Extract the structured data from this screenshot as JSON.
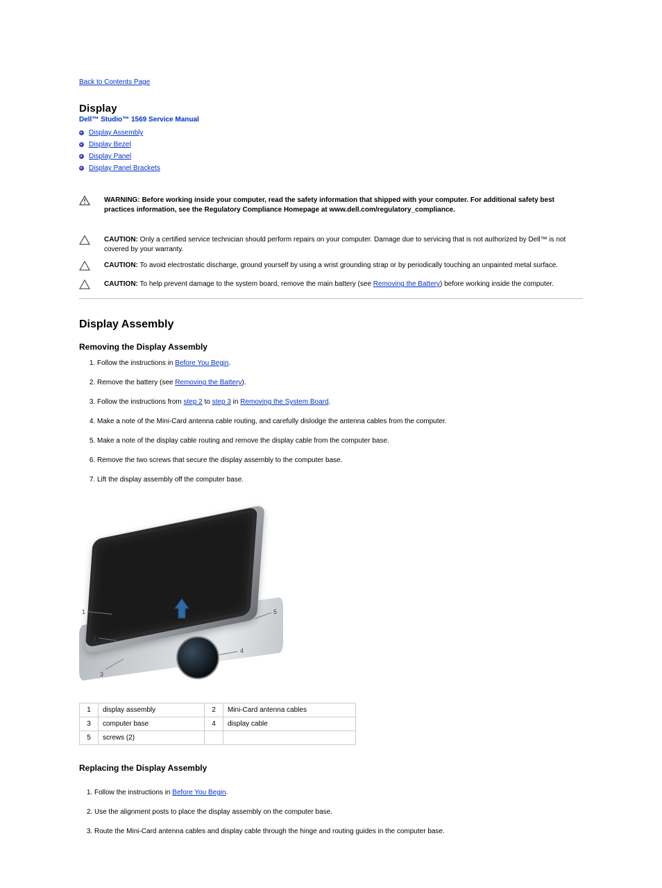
{
  "back_link": "Back to Contents Page",
  "page_title": "Display",
  "subtitle": "Dell™ Studio™ 1569 Service Manual",
  "nav": [
    "Display Assembly",
    "Display Bezel",
    "Display Panel",
    "Display Panel Brackets"
  ],
  "warning": {
    "label": "WARNING:",
    "body": "Before working inside your computer, read the safety information that shipped with your computer. For additional safety best practices information, see the Regulatory Compliance Homepage at www.dell.com/regulatory_compliance."
  },
  "cautions": [
    {
      "label": "CAUTION:",
      "body": "Only a certified service technician should perform repairs on your computer. Damage due to servicing that is not authorized by Dell™ is not covered by your warranty."
    },
    {
      "label": "CAUTION:",
      "body": "To avoid electrostatic discharge, ground yourself by using a wrist grounding strap or by periodically touching an unpainted metal surface."
    },
    {
      "label": "CAUTION:",
      "body_before_link": "To help prevent damage to the system board, remove the main battery (see ",
      "link_text": "Removing the Battery",
      "body_after_link": ") before working inside the computer."
    }
  ],
  "sect1_title": "Display Assembly",
  "sect2a_title": "Removing the Display Assembly",
  "steps_a": [
    {
      "text_before": "Follow the instructions in ",
      "link": "Before You Begin",
      "text_after": "."
    },
    {
      "text_before": "Remove the battery (see ",
      "link": "Removing the Battery",
      "text_after": ")."
    },
    {
      "text_before": "Follow the instructions from ",
      "link1": "step 2",
      "mid": " to ",
      "link2": "step 3",
      "post": " in ",
      "link3": "Removing the System Board",
      "text_after": "."
    },
    {
      "text_plain": "Make a note of the Mini-Card antenna cable routing, and carefully dislodge the antenna cables from the computer."
    },
    {
      "text_plain": "Make a note of the display cable routing and remove the display cable from the computer base."
    },
    {
      "text_plain": "Remove the two screws that secure the display assembly to the computer base."
    },
    {
      "text_plain": "Lift the display assembly off the computer base."
    }
  ],
  "table": [
    [
      {
        "n": "1",
        "t": "display assembly"
      },
      {
        "n": "2",
        "t": "Mini-Card antenna cables"
      }
    ],
    [
      {
        "n": "3",
        "t": "computer base"
      },
      {
        "n": "4",
        "t": "display cable"
      }
    ],
    [
      {
        "n": "5",
        "t": "screws (2)"
      },
      {
        "n": "",
        "t": ""
      }
    ]
  ],
  "sect2b_title": "Replacing the Display Assembly",
  "steps_b": [
    {
      "text_before": "Follow the instructions in ",
      "link": "Before You Begin",
      "text_after": "."
    },
    {
      "text_plain": "Use the alignment posts to place the display assembly on the computer base."
    },
    {
      "text_plain": "Route the Mini-Card antenna cables and display cable through the hinge and routing guides in the computer base."
    }
  ]
}
